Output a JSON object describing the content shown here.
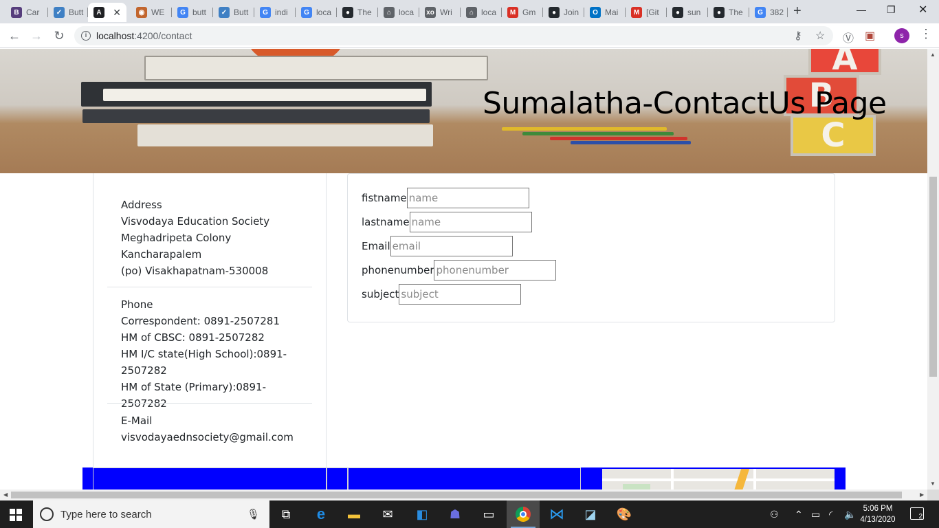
{
  "browser": {
    "tabs": [
      {
        "label": "Car",
        "favicon": "B",
        "color": "#563d7c"
      },
      {
        "label": "Butt",
        "favicon": "✓",
        "color": "#3f80c4"
      },
      {
        "label": "",
        "favicon": "A",
        "color": "#202124",
        "active": true
      },
      {
        "label": "WE",
        "favicon": "◉",
        "color": "#c2662e"
      },
      {
        "label": "butt",
        "favicon": "G",
        "color": "#4285f4"
      },
      {
        "label": "Butt",
        "favicon": "✓",
        "color": "#3f80c4"
      },
      {
        "label": "indi",
        "favicon": "G",
        "color": "#4285f4"
      },
      {
        "label": "loca",
        "favicon": "G",
        "color": "#4285f4"
      },
      {
        "label": "The",
        "favicon": "●",
        "color": "#24292e"
      },
      {
        "label": "loca",
        "favicon": "⌂",
        "color": "#5f6368"
      },
      {
        "label": "Wri",
        "favicon": "xo",
        "color": "#5f6368"
      },
      {
        "label": "loca",
        "favicon": "⌂",
        "color": "#5f6368"
      },
      {
        "label": "Gm",
        "favicon": "M",
        "color": "#d93025"
      },
      {
        "label": "Join",
        "favicon": "●",
        "color": "#24292e"
      },
      {
        "label": "Mai",
        "favicon": "O",
        "color": "#0072c6"
      },
      {
        "label": "[Git",
        "favicon": "M",
        "color": "#d93025"
      },
      {
        "label": "sun",
        "favicon": "●",
        "color": "#24292e"
      },
      {
        "label": "The",
        "favicon": "●",
        "color": "#24292e"
      },
      {
        "label": "382",
        "favicon": "G",
        "color": "#4285f4"
      }
    ],
    "url_host": "localhost",
    "url_path": ":4200/contact",
    "profile_initial": "s"
  },
  "page": {
    "title": "Sumalatha-ContactUs Page",
    "address": {
      "lines": [
        "Address",
        "Visvodaya Education Society",
        "Meghadripeta Colony",
        "Kancharapalem",
        "(po) Visakhapatnam-530008"
      ]
    },
    "phone": {
      "lines": [
        "Phone",
        "Correspondent: 0891-2507281",
        "HM of CBSC: 0891-2507282",
        "HM I/C state(High School):0891-",
        "2507282",
        "HM of State (Primary):0891-2507282"
      ]
    },
    "email": {
      "lines": [
        "E-Mail",
        "visvodayaednsociety@gmail.com"
      ]
    },
    "form": {
      "fields": [
        {
          "label": "fistname",
          "placeholder": "name"
        },
        {
          "label": "lastname",
          "placeholder": "name"
        },
        {
          "label": "Email",
          "placeholder": "email"
        },
        {
          "label": "phonenumber",
          "placeholder": "phonenumber"
        },
        {
          "label": "subject",
          "placeholder": "subject"
        }
      ]
    }
  },
  "taskbar": {
    "search_placeholder": "Type here to search",
    "time": "5:06 PM",
    "date": "4/13/2020",
    "notification_count": "2"
  }
}
